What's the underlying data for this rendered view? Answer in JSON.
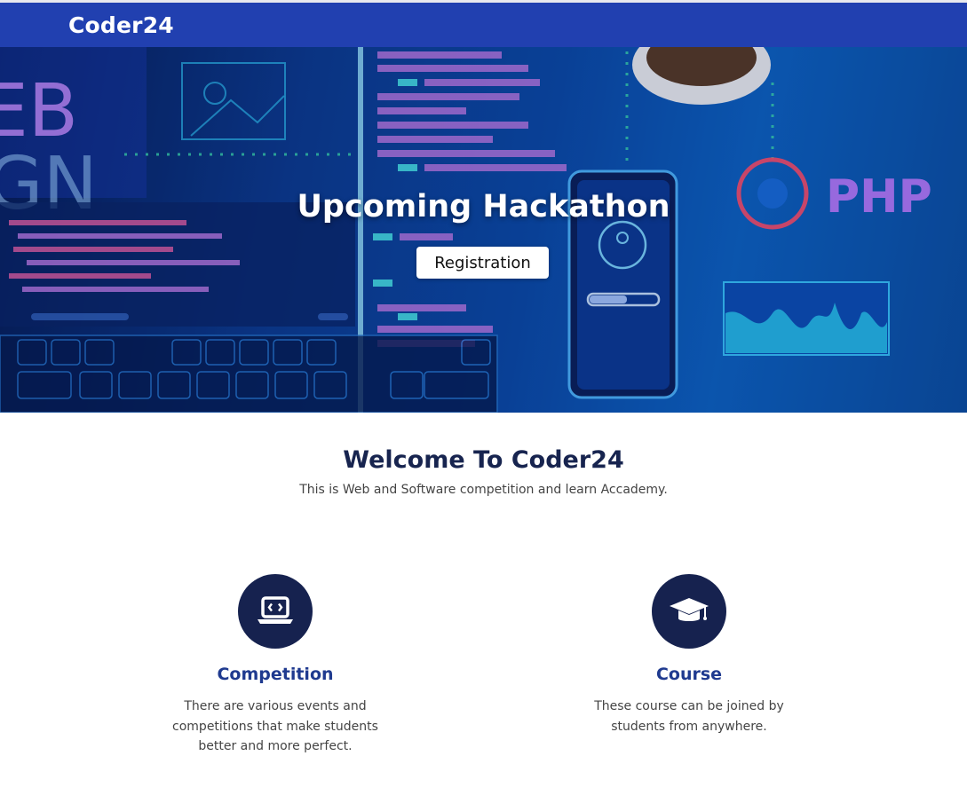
{
  "navbar": {
    "brand": "Coder24"
  },
  "hero": {
    "title": "Upcoming Hackathon",
    "button_label": "Registration",
    "background_text": {
      "left_word_1": "EB",
      "left_word_2": "GN",
      "right_word": "PHP"
    }
  },
  "welcome": {
    "title": "Welcome To Coder24",
    "subtitle": "This is Web and Software competition and learn Accademy."
  },
  "features": [
    {
      "icon": "laptop-code-icon",
      "title": "Competition",
      "description": "There are various events and competitions that make students better and more perfect."
    },
    {
      "icon": "graduation-cap-icon",
      "title": "Course",
      "description": "These course can be joined by students from anywhere."
    }
  ],
  "colors": {
    "navbar": "#2140b0",
    "icon_circle": "#16224f",
    "feature_title": "#1f3a8f",
    "heading": "#17244f"
  }
}
